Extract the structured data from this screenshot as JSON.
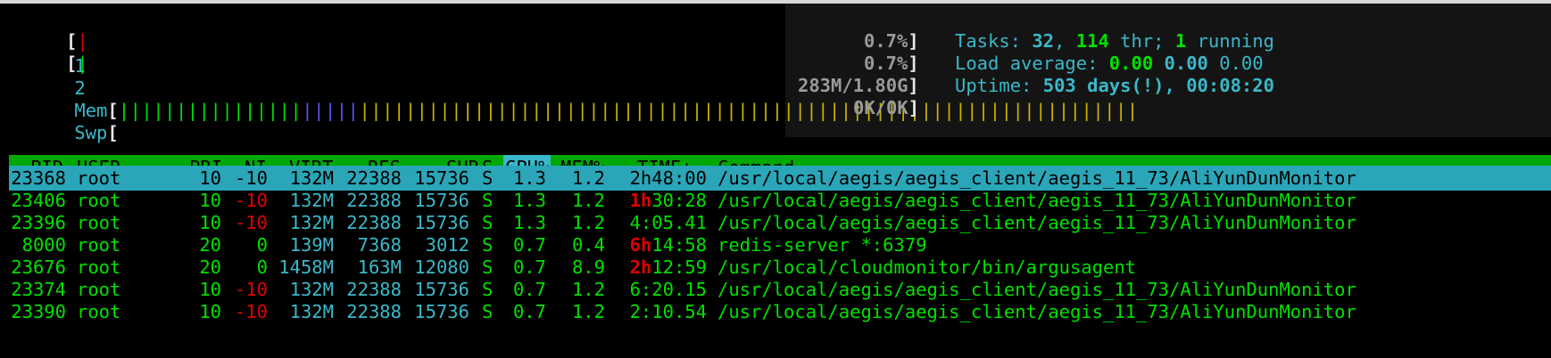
{
  "meters": {
    "cpu1": {
      "label": "1",
      "bar": "|",
      "value": "0.7%"
    },
    "cpu2": {
      "label": "2",
      "bar": "|",
      "value": "0.7%"
    },
    "mem": {
      "label": "Mem",
      "bar_green": "||||||||||||||||",
      "bar_blue": "|||||",
      "bar_yellow": "||||||||||||||||||||||||||||||||||||||||||||||||||||||||||||||||||||",
      "value": "283M/1.80G"
    },
    "swp": {
      "label": "Swp",
      "value": "0K/0K"
    }
  },
  "tasks": {
    "label": "Tasks:",
    "count": "32",
    "thr": "114",
    "thr_label": "thr;",
    "running": "1",
    "running_label": "running"
  },
  "load": {
    "label": "Load average:",
    "v1": "0.00",
    "v2": "0.00",
    "v3": "0.00"
  },
  "uptime": {
    "label": "Uptime:",
    "value": "503 days(!), 00:08:20"
  },
  "columns": {
    "pid": "PID",
    "user": "USER",
    "pri": "PRI",
    "ni": "NI",
    "virt": "VIRT",
    "res": "RES",
    "shr": "SHR",
    "s": "S",
    "cpu": "CPU%",
    "mem": "MEM%",
    "time": "TIME+",
    "command": "Command"
  },
  "processes": [
    {
      "pid": "23368",
      "user": "root",
      "pri": "10",
      "ni": "-10",
      "virt": "132M",
      "res": "22388",
      "shr": "15736",
      "s": "S",
      "cpu": "1.3",
      "mem": "1.2",
      "time_h": "",
      "time_rest": "2h48:00",
      "command": "/usr/local/aegis/aegis_client/aegis_11_73/AliYunDunMonitor",
      "selected": true
    },
    {
      "pid": "23406",
      "user": "root",
      "pri": "10",
      "ni": "-10",
      "virt": "132M",
      "res": "22388",
      "shr": "15736",
      "s": "S",
      "cpu": "1.3",
      "mem": "1.2",
      "time_h": "1h",
      "time_rest": "30:28",
      "command": "/usr/local/aegis/aegis_client/aegis_11_73/AliYunDunMonitor",
      "selected": false
    },
    {
      "pid": "23396",
      "user": "root",
      "pri": "10",
      "ni": "-10",
      "virt": "132M",
      "res": "22388",
      "shr": "15736",
      "s": "S",
      "cpu": "1.3",
      "mem": "1.2",
      "time_h": "",
      "time_rest": "4:05.41",
      "command": "/usr/local/aegis/aegis_client/aegis_11_73/AliYunDunMonitor",
      "selected": false
    },
    {
      "pid": "8000",
      "user": "root",
      "pri": "20",
      "ni": "0",
      "virt": "139M",
      "res": "7368",
      "shr": "3012",
      "s": "S",
      "cpu": "0.7",
      "mem": "0.4",
      "time_h": "6h",
      "time_rest": "14:58",
      "command": "redis-server *:6379",
      "selected": false
    },
    {
      "pid": "23676",
      "user": "root",
      "pri": "20",
      "ni": "0",
      "virt": "1458M",
      "res": "163M",
      "shr": "12080",
      "s": "S",
      "cpu": "0.7",
      "mem": "8.9",
      "time_h": "2h",
      "time_rest": "12:59",
      "command": "/usr/local/cloudmonitor/bin/argusagent",
      "selected": false
    },
    {
      "pid": "23374",
      "user": "root",
      "pri": "10",
      "ni": "-10",
      "virt": "132M",
      "res": "22388",
      "shr": "15736",
      "s": "S",
      "cpu": "0.7",
      "mem": "1.2",
      "time_h": "",
      "time_rest": "6:20.15",
      "command": "/usr/local/aegis/aegis_client/aegis_11_73/AliYunDunMonitor",
      "selected": false
    },
    {
      "pid": "23390",
      "user": "root",
      "pri": "10",
      "ni": "-10",
      "virt": "132M",
      "res": "22388",
      "shr": "15736",
      "s": "S",
      "cpu": "0.7",
      "mem": "1.2",
      "time_h": "",
      "time_rest": "2:10.54",
      "command": "/usr/local/aegis/aegis_client/aegis_11_73/AliYunDunMonitor",
      "selected": false
    }
  ]
}
